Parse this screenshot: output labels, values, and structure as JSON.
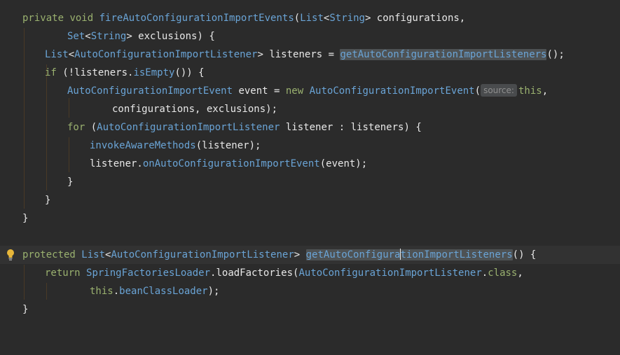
{
  "editor": {
    "hint_label": "source:",
    "lines": {
      "l1": {
        "kw_private": "private",
        "kw_void": "void",
        "method_name": "fireAutoConfigurationImportEvents",
        "paren_open": "(",
        "type_list": "List",
        "lt": "<",
        "type_string": "String",
        "gt": ">",
        "param": " configurations,"
      },
      "l2": {
        "type_set": "Set",
        "lt": "<",
        "type_string": "String",
        "gt": ">",
        "rest": " exclusions) {"
      },
      "l3": {
        "type_list": "List",
        "lt": "<",
        "type_listener": "AutoConfigurationImportListener",
        "gt": ">",
        "mid": " listeners = ",
        "call": "getAutoConfigurationImportListeners",
        "tail": "();"
      },
      "l4": {
        "kw_if": "if",
        "mid": " (!listeners.",
        "call": "isEmpty",
        "tail": "()) {"
      },
      "l5": {
        "type_event": "AutoConfigurationImportEvent",
        "mid": " event = ",
        "kw_new": "new",
        "ctor": "AutoConfigurationImportEvent",
        "paren": "(",
        "kw_this": "this",
        "tail": ","
      },
      "l6": {
        "text": "configurations, exclusions);"
      },
      "l7": {
        "kw_for": "for",
        "paren": " (",
        "type_listener": "AutoConfigurationImportListener",
        "tail": " listener : listeners) {"
      },
      "l8": {
        "call": "invokeAwareMethods",
        "tail": "(listener);"
      },
      "l9": {
        "head": "listener.",
        "call": "onAutoConfigurationImportEvent",
        "tail": "(event);"
      },
      "l10": {
        "text": "}"
      },
      "l11": {
        "text": "}"
      },
      "l12": {
        "text": "}"
      },
      "l14": {
        "kw_protected": "protected",
        "type_list": "List",
        "lt": "<",
        "type_listener": "AutoConfigurationImportListener",
        "gt": ">",
        "method_a": "getAutoConfigura",
        "method_b": "tionImportListeners",
        "tail": "() {"
      },
      "l15": {
        "kw_return": "return",
        "type_loader": "SpringFactoriesLoader",
        "dot": ".",
        "call": "loadFactories",
        "paren": "(",
        "type_listener": "AutoConfigurationImportListener",
        "dot2": ".",
        "kw_class": "class",
        "tail": ","
      },
      "l16": {
        "kw_this": "this",
        "dot": ".",
        "field": "beanClassLoader",
        "tail": ");"
      },
      "l17": {
        "text": "}"
      }
    }
  },
  "colors": {
    "background": "#2b2b2b",
    "keyword": "#cc7832",
    "type": "#6aa4d6",
    "text": "#e8e8e8",
    "highlight": "#4e5254",
    "current_line": "#323232"
  },
  "icons": {
    "gutter": "lightbulb-icon"
  }
}
